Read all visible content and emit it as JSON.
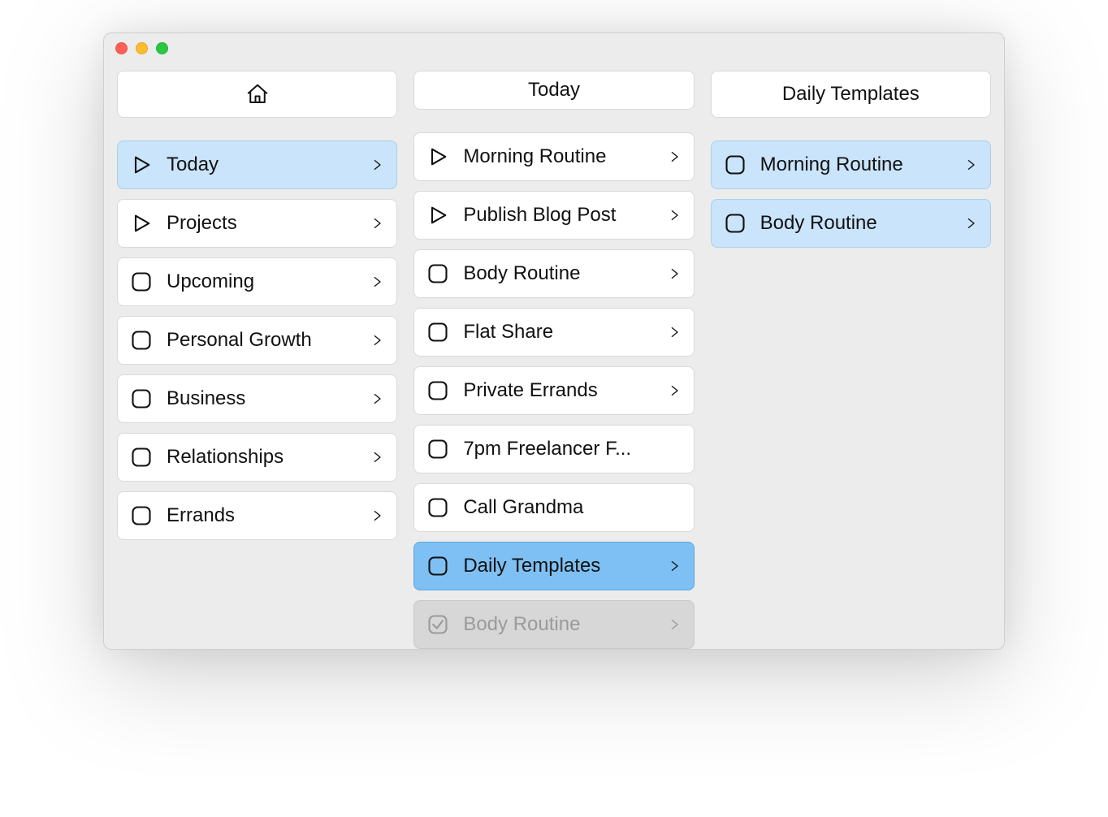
{
  "columns": [
    {
      "header": {
        "type": "icon",
        "icon": "home-icon",
        "text": ""
      },
      "items": [
        {
          "icon": "play",
          "label": "Today",
          "chevron": true,
          "state": "sel-light"
        },
        {
          "icon": "play",
          "label": "Projects",
          "chevron": true,
          "state": ""
        },
        {
          "icon": "checkbox",
          "label": "Upcoming",
          "chevron": true,
          "state": ""
        },
        {
          "icon": "checkbox",
          "label": "Personal Growth",
          "chevron": true,
          "state": ""
        },
        {
          "icon": "checkbox",
          "label": "Business",
          "chevron": true,
          "state": ""
        },
        {
          "icon": "checkbox",
          "label": "Relationships",
          "chevron": true,
          "state": ""
        },
        {
          "icon": "checkbox",
          "label": "Errands",
          "chevron": true,
          "state": ""
        }
      ]
    },
    {
      "header": {
        "type": "text",
        "text": "Today"
      },
      "items": [
        {
          "icon": "play",
          "label": "Morning Routine",
          "chevron": true,
          "state": ""
        },
        {
          "icon": "play",
          "label": "Publish Blog Post",
          "chevron": true,
          "state": ""
        },
        {
          "icon": "checkbox",
          "label": "Body Routine",
          "chevron": true,
          "state": ""
        },
        {
          "icon": "checkbox",
          "label": "Flat Share",
          "chevron": true,
          "state": ""
        },
        {
          "icon": "checkbox",
          "label": "Private Errands",
          "chevron": true,
          "state": ""
        },
        {
          "icon": "checkbox",
          "label": "7pm Freelancer F...",
          "chevron": false,
          "state": ""
        },
        {
          "icon": "checkbox",
          "label": "Call Grandma",
          "chevron": false,
          "state": ""
        },
        {
          "icon": "checkbox",
          "label": "Daily Templates",
          "chevron": true,
          "state": "sel-strong"
        },
        {
          "icon": "checked",
          "label": "Body Routine",
          "chevron": true,
          "state": "completed"
        }
      ]
    },
    {
      "header": {
        "type": "text",
        "text": "Daily Templates"
      },
      "items": [
        {
          "icon": "checkbox",
          "label": "Morning Routine",
          "chevron": true,
          "state": "sel-light"
        },
        {
          "icon": "checkbox",
          "label": "Body Routine",
          "chevron": true,
          "state": "sel-light"
        }
      ]
    }
  ]
}
